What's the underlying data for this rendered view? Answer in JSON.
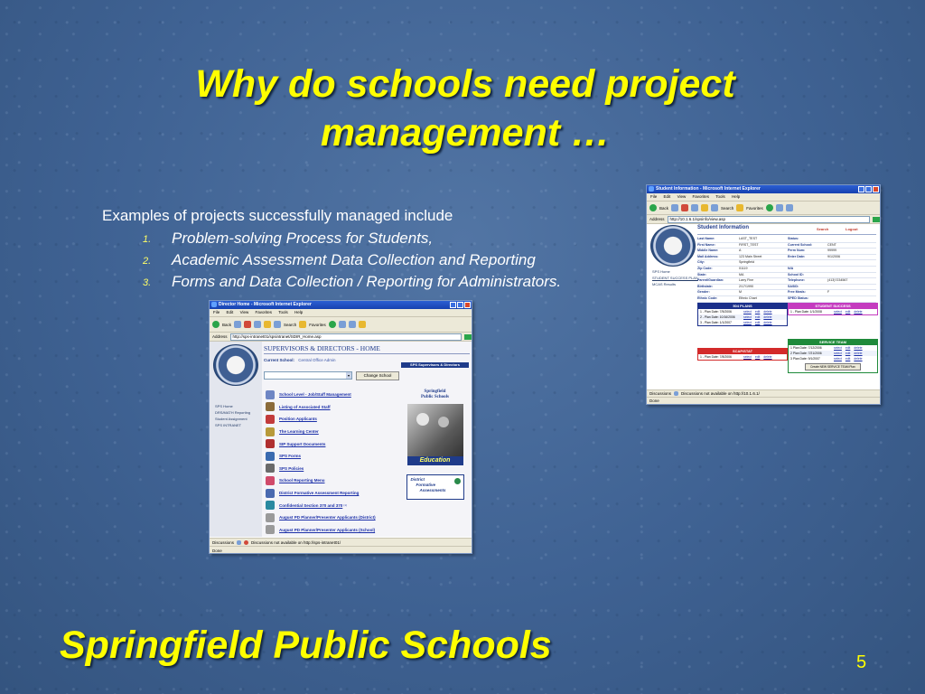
{
  "slide": {
    "title": "Why do schools need project management …",
    "intro": "Examples of projects successfully managed include",
    "projects": [
      {
        "num": "1.",
        "text": "Problem-solving Process for Students,"
      },
      {
        "num": "2.",
        "text": "Academic Assessment Data Collection and Reporting"
      },
      {
        "num": "3.",
        "text": "Forms and Data Collection / Reporting for Administrators."
      }
    ],
    "footer": "Springfield Public Schools",
    "page_number": "5"
  },
  "colors": {
    "title": "#ffff00",
    "background": "#4a6b9a",
    "text": "#ffffff"
  },
  "screenshot_student": {
    "window_title": "Student Information - Microsoft Internet Explorer",
    "menu": [
      "File",
      "Edit",
      "View",
      "Favorites",
      "Tools",
      "Help"
    ],
    "back": "Back",
    "search": "Search",
    "favorites": "Favorites",
    "address_label": "Address",
    "address": "http://10.1.6.1/spsinfo/view.asp",
    "header": "Student Information",
    "search_link": "Search",
    "logout_link": "Logout",
    "side_links": [
      "SPS Home",
      "STUDENT SUCCESS PLAN",
      "MCAS Results"
    ],
    "fields_left": [
      {
        "label": "Last Name:",
        "value": "LAST_TEST"
      },
      {
        "label": "First Name:",
        "value": "FIRST_TEST"
      },
      {
        "label": "Middle Name:",
        "value": "A"
      },
      {
        "label": "Mail Address:",
        "value": "123 Main Street"
      },
      {
        "label": "City:",
        "value": "Springfield"
      },
      {
        "label": "Zip Code:",
        "value": "01119"
      },
      {
        "label": "State:",
        "value": "MA"
      },
      {
        "label": "Parent/Guardian:",
        "value": "Larry Fine"
      },
      {
        "label": "Birthdate:",
        "value": "2/17/1990"
      },
      {
        "label": "Gender:",
        "value": "M"
      },
      {
        "label": "Ethnic Code:",
        "value": "Ethnic Chart"
      }
    ],
    "fields_right": [
      {
        "label": "Status:",
        "value": ""
      },
      {
        "label": "Current School:",
        "value": "CENT"
      },
      {
        "label": "Perm Num:",
        "value": "99999"
      },
      {
        "label": "Enter Date:",
        "value": "9/1/2006"
      },
      {
        "label": "",
        "value": ""
      },
      {
        "label": "N/A",
        "value": ""
      },
      {
        "label": "School ID:",
        "value": ""
      },
      {
        "label": "Telephone:",
        "value": "(413)?234567"
      },
      {
        "label": "SASID:",
        "value": ""
      },
      {
        "label": "Free Meals:",
        "value": "F"
      },
      {
        "label": "SPED Status:",
        "value": ""
      }
    ],
    "panels": [
      {
        "title": "504 PLANS",
        "color": "#1a2f8a",
        "rows": [
          "1 - Plan Date: 7/5/2006",
          "2 - Plan Date: 10/16/2006",
          "3 - Plan Date: 1/1/2007"
        ]
      },
      {
        "title": "STUDENT SUCCESS",
        "color": "#c43bbf",
        "rows": [
          "1 - Plan Date: 1/1/2008"
        ]
      },
      {
        "title": "SCAP/STAT",
        "color": "#d32a2a",
        "rows": [
          "1 - Plan Date: 7/8/2006"
        ]
      },
      {
        "title": "SERVICE TEAM",
        "color": "#1f8a3a",
        "rows": [
          "1 Plan Date: 7/12/2006",
          "2 Plan Date: 7/21/2006",
          "3 Plan Date: 9/1/2007"
        ],
        "button": "Create NEW SERVICE TEAM Plan"
      }
    ],
    "row_links": [
      "select",
      "edit",
      "delete"
    ],
    "discussions": "Discussions",
    "status_note": "Discussions not available on http://10.1.6.1/",
    "done": "Done"
  },
  "screenshot_directors": {
    "window_title": "Director Home - Microsoft Internet Explorer",
    "menu": [
      "File",
      "Edit",
      "View",
      "Favorites",
      "Tools",
      "Help"
    ],
    "back": "Back",
    "search": "Search",
    "favorites": "Favorites",
    "address_label": "Address",
    "address": "http://sps-intranet01/spsintranet/SDIR_Home.asp",
    "header": "SUPERVISORS & DIRECTORS - HOME",
    "current_school_label": "Current School:",
    "current_school_value": "Central Office Admin",
    "badge": "SPS Supervisors & Directors",
    "change_school": "Change School",
    "side_links": [
      "SPS Home",
      "DRS/MATH Reporting",
      "Student Assignment",
      "SPS INTRANET"
    ],
    "links": [
      {
        "label": "School Level - Job/Staff Management",
        "color": "#6e86c4"
      },
      {
        "label": "Listing of Associated Staff",
        "color": "#8b6b3a"
      },
      {
        "label": "Position Applicants",
        "color": "#c23b3b"
      },
      {
        "label": "The Learning Center",
        "color": "#b89a3a"
      },
      {
        "label": "SIP Support Documents",
        "color": "#b03030"
      },
      {
        "label": "SPS Forms",
        "color": "#3a6bb0"
      },
      {
        "label": "SPS Policies",
        "color": "#6a6a6a"
      },
      {
        "label": "School Reporting Menu",
        "color": "#d04a6a"
      },
      {
        "label": "District Formative Assessment Reporting",
        "color": "#4a6ab0"
      },
      {
        "label": "Confidential Section 370 and 370",
        "color": "#2a8aa0"
      },
      {
        "label": "August PD Planner/Presenter Applicants (District)",
        "color": "#9a9a9a"
      },
      {
        "label": "August PD Planner/Presenter Applicants (School)",
        "color": "#9a9a9a"
      }
    ],
    "confidential_sup": "(1)",
    "right_title_1": "Springfield",
    "right_title_2": "Public Schools",
    "photo_caption": "Education",
    "dfa_label_1": "District",
    "dfa_label_2": "Formative",
    "dfa_label_3": "Assessments",
    "discussions": "Discussions",
    "status_note": "Discussions not available on http://sps-intranet01/",
    "done": "Done"
  }
}
